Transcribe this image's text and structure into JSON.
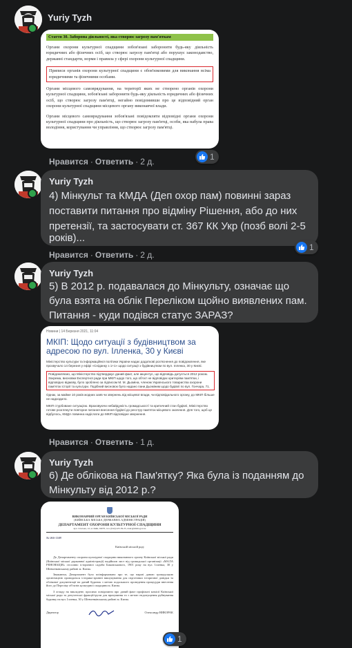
{
  "author": "Yuriy Tyzh",
  "actions": {
    "like": "Нравится",
    "reply": "Ответить"
  },
  "comments": [
    {
      "time": "2 д.",
      "likes": "1",
      "image": {
        "title": "Стаття 30. Заборона діяльності, яка створює загрозу пам'яткам",
        "p1": "Органи охорони культурної спадщини зобов'язані заборонити будь-яку діяльність юридичних або фізичних осіб, що створює загрозу пам'ятці або порушує законодавство, державні стандарти, норми і правила у сфері охорони культурної спадщини.",
        "p2": "Приписи органів охорони культурної спадщини є обов'язковими для виконання всіма юридичними та фізичними особами.",
        "p3": "Органи місцевого самоврядування, на території яких не створено органів охорони культурної спадщини, зобов'язані заборонити будь-яку діяльність юридичних або фізичних осіб, що створює загрозу пам'ятці, негайно повідомивши про це відповідний орган охорони культурної спадщини місцевого органу виконавчої влади.",
        "p4": "Органи місцевого самоврядування зобов'язані повідомляти відповідні органи охорони культурної спадщини про діяльність, що створює загрозу пам'ятці, особи, яка набула права володіння, користування чи управління, що створює загрозу пам'ятці."
      }
    },
    {
      "text": "4) Мінкульт та КМДА (Деп охор пам) повинні зараз поставити питання про відміну Рішення, або до них претензії, та застосувати ст. 367 КК Укр (позб волі 2-5 років)...",
      "lines": [
        "4) Мінкульт та КМДА (Деп охор пам) повинні зараз",
        "поставити питання про відміну Рішення, або до них",
        "претензії, та застосувати ст. 367 КК Укр (позб волі 2-5",
        "років)..."
      ],
      "time": "2 д.",
      "likes": "1"
    },
    {
      "lines": [
        "5) В 2012 р. подавалася до Мінкульту, означає що",
        "була взята на облік Переліком щойно виявлених пам.",
        "Питання - куди подівся статус ЗАРАЗ?"
      ],
      "time": "1 д.",
      "image": {
        "date": "Новини | 14 Березня 2021, 11:04",
        "headline": "МКІП: Щодо ситуації з будівництвом за адресою по вул. Ілленка, 30 у Києві",
        "p1": "Міністерство культури та інформаційної політики України надає додаткові роз'яснення до повідомлення, яке прозвучало 14 березня у ефірі «Сніданку з 1+1» щодо ситуації з будівництвом по вул. Ілленка, 30 у Києві.",
        "p2": "Повідомляємо, що Міністерство підтверджує даний факт, але акцентує, що відповідь датується 2012 роком. Зокрема, висновки Експертної ради при МКІП щодо того, що об'єкт не відповідає критеріям пам'ятки, і відповідно відмову, було зроблено за підписом М. М. Дьоміна, членом Українського товариства охорони пам'яток історії та культури. Подібний висновок було надано пани Дьоміним щодо будівлі по вул. Гончара, 71.",
        "p3": "Однак, за майже 10 років жодних заяв чи звернень від місцевої влади, чи відповідального органу, до МКІП більше не надходило.",
        "p4": "МКІП стурбоване ситуацією. Враховуючи небайдужість громадськості та критичний стан будівлі, Міністерство готове розглянути повторне питання внесення будівлі до реєстру пам'яток місцевого значення. Для того, щоб це відбулось, КМДА повинна надіслати до МКІП відповідне звернення."
      }
    },
    {
      "lines": [
        "6) Де облікова на Пам'ятку? Яка була із поданням до",
        "Мінкульту від 2012 р.?"
      ],
      "likes": "1",
      "image": {
        "org1": "ВИКОНАВЧИЙ ОРГАН КИЇВСЬКОЇ МІСЬКОЇ РАДИ",
        "org2": "(КИЇВСЬКА МІСЬКА ДЕРЖАВНА АДМІНІСТРАЦІЯ)",
        "dept": "ДЕПАРТАМЕНТ ОХОРОНИ КУЛЬТУРНОЇ СПАДЩИНИ",
        "address": "вул. Спаська, 12, м. Київ, 04070, тел. (044) 425-39-25, dokc@kmda.gov.ua",
        "refno": "№ 066-1188",
        "recipient": "Київській міській раді",
        "body1": "До Департаменту охорони культурної спадщини виконавчого органу Київської міської ради (Київської міської державної адміністрації) надійшов лист від громадської організації «МАЛА РЕНОВАЦІЯ» стосовно історичної садиби Биковськового, 1901 року на вул. Ілленка, 30 у Шевченківському районі м. Києва.",
        "body2": "Зважаючи, Департамент було поінформовано про те, що наразі даною громадською організацією проводяться історико-архівні вишукування для підготовки історичної довідки та облікової документації на даний будинок з метою подальшого проведення процедури внесення його до Переліку об'єктів культурної спадщини м. Києва.",
        "body3": "З огляду на викладене, просимо повідомити про даний факт профільні комісії Київської міської ради та депутатські фракції/групи для врахування та з метою недопущення руйнування будинку на вул. Ілленка, 30 у Шевченківському районі м. Києва.",
        "signer_role": "Директор",
        "signer_name": "Олександр НИКОРАК"
      }
    }
  ],
  "colors": {
    "background": "#18191a",
    "bubble": "#3a3b3c",
    "text": "#e4e6eb",
    "meta": "#b0b3b8",
    "like_blue": "#1877f2",
    "online_green": "#31a24c",
    "highlight_red": "#d9262c"
  }
}
